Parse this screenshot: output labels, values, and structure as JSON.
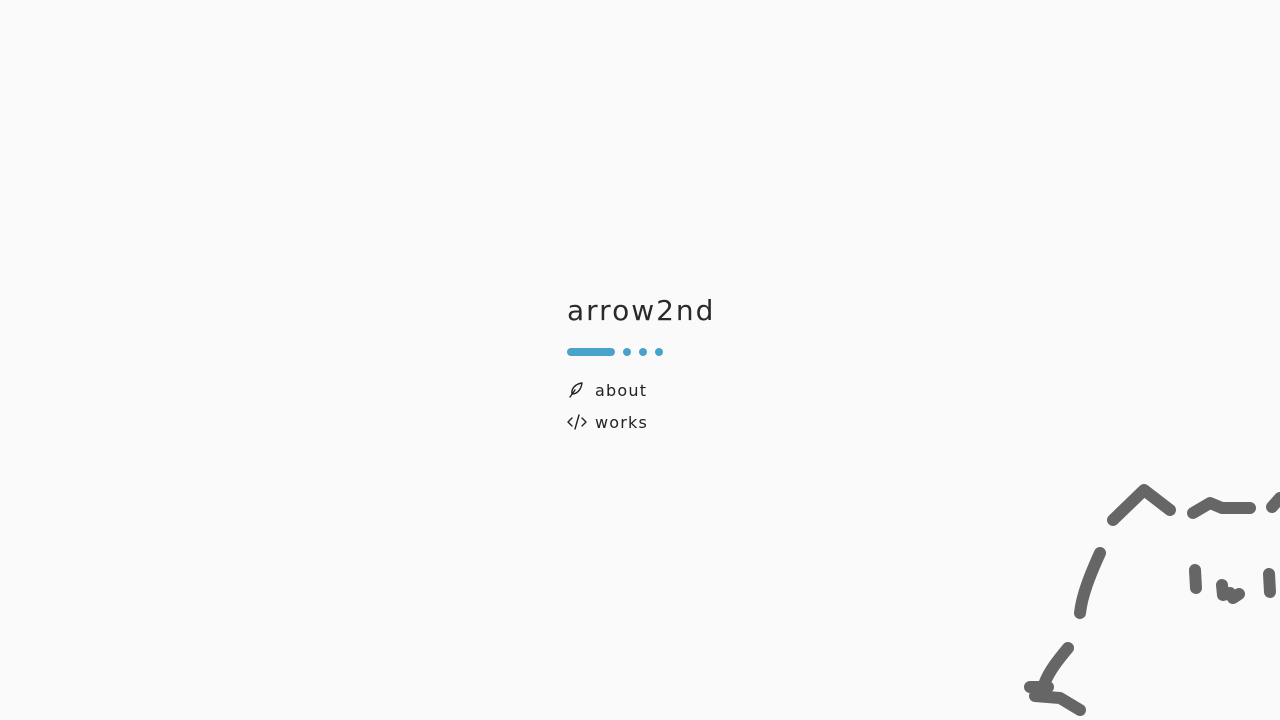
{
  "site": {
    "title": "arrow2nd"
  },
  "theme": {
    "accent": "#4aa3c8",
    "text": "#2a2a2a",
    "background": "#fafafa",
    "illustration_stroke": "#666666"
  },
  "nav": {
    "items": [
      {
        "label": "about",
        "icon": "feather-icon"
      },
      {
        "label": "works",
        "icon": "code-icon"
      }
    ]
  },
  "illustration": {
    "icon": "cat-illustration"
  }
}
